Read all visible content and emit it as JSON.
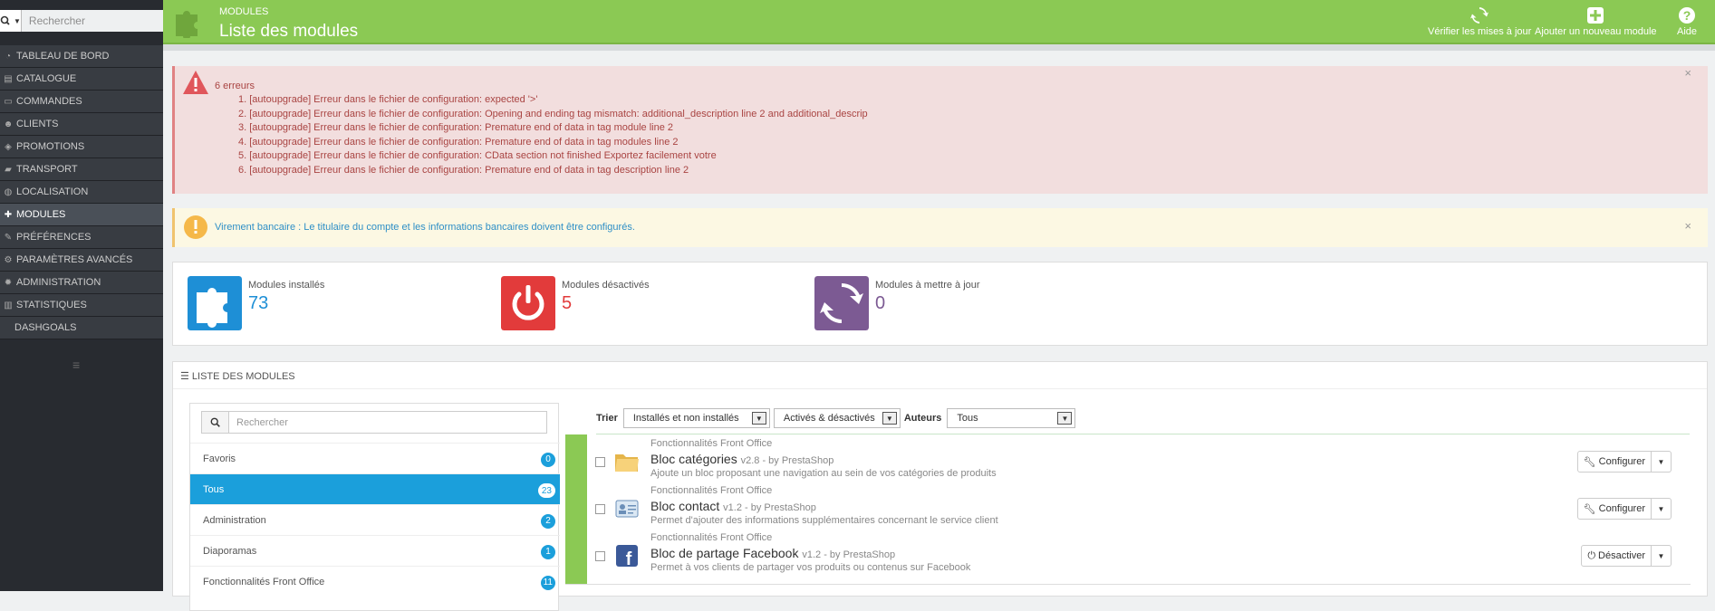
{
  "sidebar": {
    "search_placeholder": "Rechercher",
    "items": [
      {
        "label": "TABLEAU DE BORD",
        "icon": "dashboard-icon"
      },
      {
        "label": "CATALOGUE",
        "icon": "catalog-icon"
      },
      {
        "label": "COMMANDES",
        "icon": "credit-card-icon"
      },
      {
        "label": "CLIENTS",
        "icon": "users-icon"
      },
      {
        "label": "PROMOTIONS",
        "icon": "tag-icon"
      },
      {
        "label": "TRANSPORT",
        "icon": "truck-icon"
      },
      {
        "label": "LOCALISATION",
        "icon": "globe-icon"
      },
      {
        "label": "MODULES",
        "icon": "puzzle-icon",
        "active": true
      },
      {
        "label": "PRÉFÉRENCES",
        "icon": "wrench-icon"
      },
      {
        "label": "PARAMÈTRES AVANCÉS",
        "icon": "cogs-icon"
      },
      {
        "label": "ADMINISTRATION",
        "icon": "cog-icon"
      },
      {
        "label": "STATISTIQUES",
        "icon": "bar-chart-icon"
      },
      {
        "label": "DASHGOALS",
        "icon": ""
      }
    ]
  },
  "header": {
    "breadcrumb": "MODULES",
    "title": "Liste des modules",
    "toolbar": {
      "check_updates": "Vérifier les mises à jour",
      "add_module": "Ajouter un nouveau module",
      "help": "Aide"
    },
    "color": "#8bc954"
  },
  "errors": {
    "title": "6 erreurs",
    "items": [
      "1.  [autoupgrade] Erreur dans le fichier de configuration: expected '>'",
      "2.  [autoupgrade] Erreur dans le fichier de configuration: Opening and ending tag mismatch: additional_description line 2 and additional_descrip",
      "3.  [autoupgrade] Erreur dans le fichier de configuration: Premature end of data in tag module line 2",
      "4.  [autoupgrade] Erreur dans le fichier de configuration: Premature end of data in tag modules line 2",
      "5.  [autoupgrade] Erreur dans le fichier de configuration: CData section not finished Exportez facilement votre",
      "6.  [autoupgrade] Erreur dans le fichier de configuration: Premature end of data in tag description line 2"
    ],
    "close": "×"
  },
  "warning": {
    "text": "Virement bancaire : Le titulaire du compte et les informations bancaires doivent être configurés.",
    "close": "×"
  },
  "kpis": [
    {
      "label": "Modules installés",
      "value": "73",
      "color": "#1e8fd6"
    },
    {
      "label": "Modules désactivés",
      "value": "5",
      "color": "#e23b3b"
    },
    {
      "label": "Modules à mettre à jour",
      "value": "0",
      "color": "#7c5a93"
    }
  ],
  "module_list": {
    "heading": "LISTE DES MODULES",
    "search_placeholder": "Rechercher",
    "categories": [
      {
        "label": "Favoris",
        "count": "0"
      },
      {
        "label": "Tous",
        "count": "23",
        "active": true
      },
      {
        "label": "Administration",
        "count": "2"
      },
      {
        "label": "Diaporamas",
        "count": "1"
      },
      {
        "label": "Fonctionnalités Front Office",
        "count": "11"
      }
    ],
    "filters": {
      "sort_label": "Trier",
      "install_filter": "Installés et non installés",
      "status_filter": "Activés & désactivés",
      "authors_label": "Auteurs",
      "authors_value": "Tous"
    },
    "modules": [
      {
        "category": "Fonctionnalités Front Office",
        "name": "Bloc catégories",
        "version": "v2.8 - by PrestaShop",
        "description": "Ajoute un bloc proposant une navigation au sein de vos catégories de produits",
        "action": "Configurer",
        "icon": "folder-icon"
      },
      {
        "category": "Fonctionnalités Front Office",
        "name": "Bloc contact",
        "version": "v1.2 - by PrestaShop",
        "description": "Permet d'ajouter des informations supplémentaires concernant le service client",
        "action": "Configurer",
        "icon": "contact-card-icon"
      },
      {
        "category": "Fonctionnalités Front Office",
        "name": "Bloc de partage Facebook",
        "version": "v1.2 - by PrestaShop",
        "description": "Permet à vos clients de partager vos produits ou contenus sur Facebook",
        "action": "Désactiver",
        "icon": "facebook-icon"
      }
    ]
  }
}
